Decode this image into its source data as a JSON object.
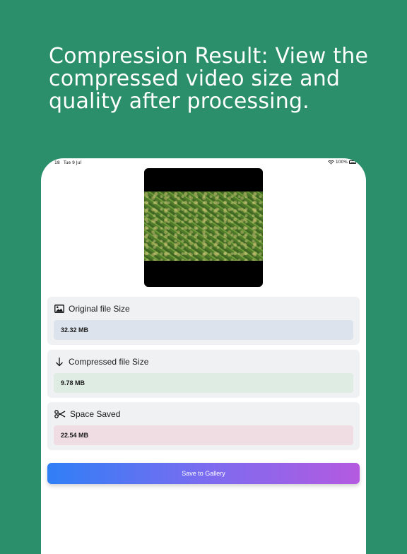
{
  "headline": "Compression Result: View the compressed video size and quality after processing.",
  "status_bar": {
    "time": "18",
    "date": "Tue 9 Jul",
    "battery": "100%",
    "icons": [
      "wifi-icon",
      "battery-icon"
    ]
  },
  "video": {
    "thumbnail_icon": "video-preview"
  },
  "cards": [
    {
      "label": "Original file Size",
      "value": "32.32 MB",
      "icon": "image-icon",
      "value_bg": "#dde3ec"
    },
    {
      "label": "Compressed file Size",
      "value": "9.78 MB",
      "icon": "download-arrow-icon",
      "value_bg": "#dfece4"
    },
    {
      "label": "Space Saved",
      "value": "22.54 MB",
      "icon": "scissors-icon",
      "value_bg": "#efdde3"
    }
  ],
  "save_button": {
    "label": "Save to Gallery",
    "gradient": [
      "#2f7ff6",
      "#b45ae0"
    ]
  },
  "colors": {
    "background": "#2b8f6b",
    "card_bg": "#f0f1f3"
  }
}
